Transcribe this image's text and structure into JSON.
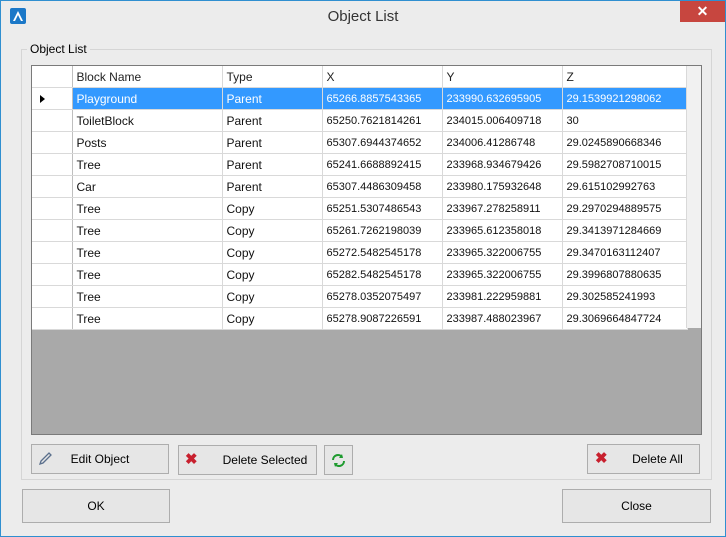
{
  "window": {
    "title": "Object List",
    "close_glyph": "✕"
  },
  "group": {
    "label": "Object List"
  },
  "table": {
    "columns": [
      "Block Name",
      "Type",
      "X",
      "Y",
      "Z"
    ],
    "rows": [
      {
        "name": "Playground",
        "type": "Parent",
        "x": "65266.8857543365",
        "y": "233990.632695905",
        "z": "29.1539921298062"
      },
      {
        "name": "ToiletBlock",
        "type": "Parent",
        "x": "65250.7621814261",
        "y": "234015.006409718",
        "z": "30"
      },
      {
        "name": "Posts",
        "type": "Parent",
        "x": "65307.6944374652",
        "y": "234006.41286748",
        "z": "29.0245890668346"
      },
      {
        "name": "Tree",
        "type": "Parent",
        "x": "65241.6688892415",
        "y": "233968.934679426",
        "z": "29.5982708710015"
      },
      {
        "name": "Car",
        "type": "Parent",
        "x": "65307.4486309458",
        "y": "233980.175932648",
        "z": "29.615102992763"
      },
      {
        "name": "Tree",
        "type": "Copy",
        "x": "65251.5307486543",
        "y": "233967.278258911",
        "z": "29.2970294889575"
      },
      {
        "name": "Tree",
        "type": "Copy",
        "x": "65261.7262198039",
        "y": "233965.612358018",
        "z": "29.3413971284669"
      },
      {
        "name": "Tree",
        "type": "Copy",
        "x": "65272.5482545178",
        "y": "233965.322006755",
        "z": "29.3470163112407"
      },
      {
        "name": "Tree",
        "type": "Copy",
        "x": "65282.5482545178",
        "y": "233965.322006755",
        "z": "29.3996807880635"
      },
      {
        "name": "Tree",
        "type": "Copy",
        "x": "65278.0352075497",
        "y": "233981.222959881",
        "z": "29.302585241993"
      },
      {
        "name": "Tree",
        "type": "Copy",
        "x": "65278.9087226591",
        "y": "233987.488023967",
        "z": "29.3069664847724"
      }
    ],
    "selected_row": 0
  },
  "buttons": {
    "edit_object": "Edit Object",
    "delete_selected": "Delete Selected",
    "delete_all": "Delete All",
    "ok": "OK",
    "close": "Close"
  },
  "icons": {
    "app": "app-logo-icon",
    "edit": "pencil-icon",
    "delete": "red-x-icon",
    "refresh": "refresh-icon"
  },
  "colors": {
    "selection": "#3399ff",
    "close_button": "#c7463f",
    "delete_icon": "#c8202e",
    "refresh_icon": "#1f9b2f"
  }
}
